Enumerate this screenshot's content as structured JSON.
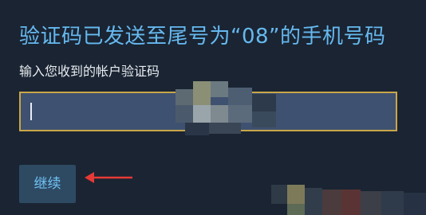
{
  "heading": "验证码已发送至尾号为“08”的手机号码",
  "input_label": "输入您收到的帐户验证码",
  "code_input": {
    "value": "",
    "placeholder": ""
  },
  "continue_button": "继续",
  "colors": {
    "heading": "#66b9ef",
    "input_border": "#c9a648",
    "input_bg": "#3f5170",
    "button_bg": "#2e4a63",
    "button_text": "#70c2f5",
    "arrow": "#e53935"
  }
}
